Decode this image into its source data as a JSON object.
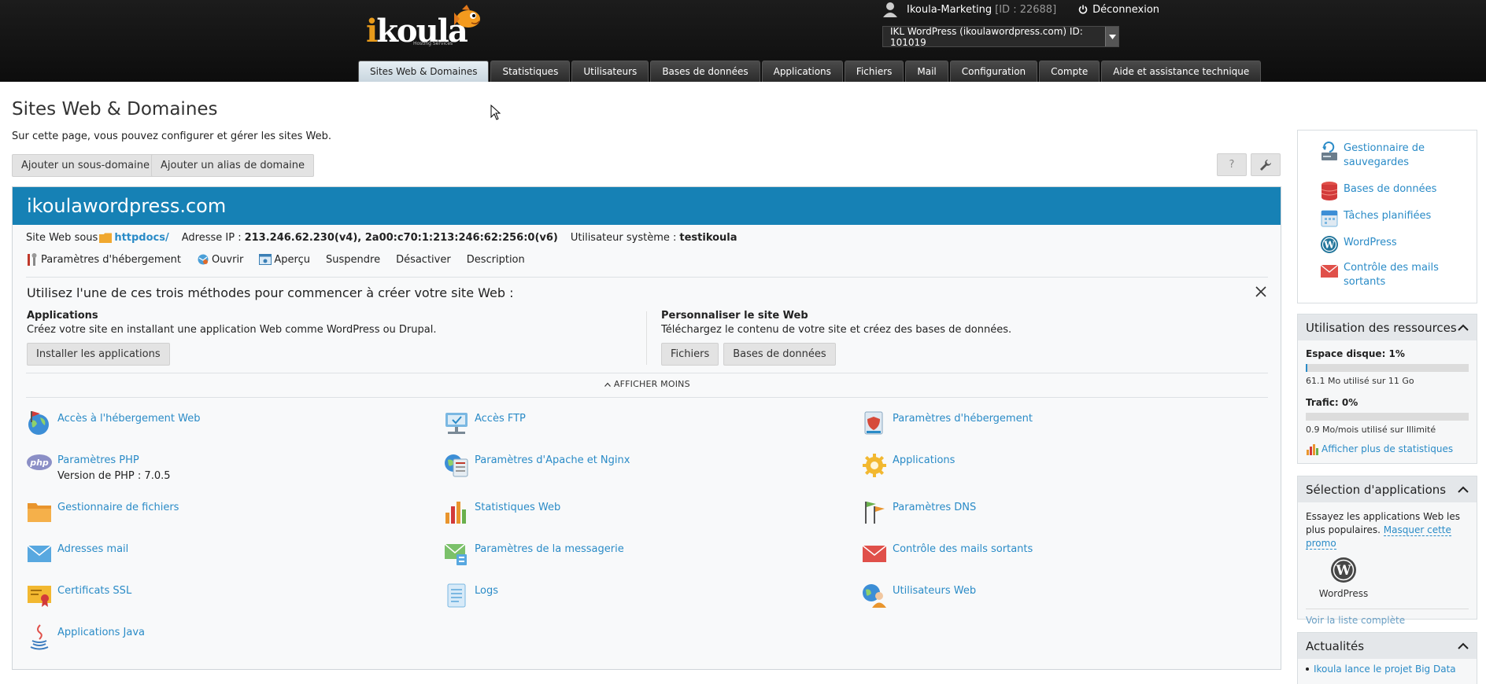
{
  "header": {
    "logo_text": "ikoula",
    "logo_sub": "Hosting Services",
    "user_name": "Ikoula-Marketing",
    "user_id": "[ID : 22688]",
    "logout_label": "Déconnexion",
    "subscription": "IKL WordPress (ikoulawordpress.com) ID: 101019"
  },
  "tabs": [
    {
      "label": "Sites Web & Domaines",
      "active": true
    },
    {
      "label": "Statistiques"
    },
    {
      "label": "Utilisateurs"
    },
    {
      "label": "Bases de données"
    },
    {
      "label": "Applications"
    },
    {
      "label": "Fichiers"
    },
    {
      "label": "Mail"
    },
    {
      "label": "Configuration"
    },
    {
      "label": "Compte"
    },
    {
      "label": "Aide et assistance technique"
    }
  ],
  "main": {
    "title": "Sites Web & Domaines",
    "description": "Sur cette page, vous pouvez configurer et gérer les sites Web.",
    "btn_subdomain": "Ajouter un sous-domaine",
    "btn_alias": "Ajouter un alias de domaine",
    "help_glyph": "?"
  },
  "domain": {
    "name": "ikoulawordpress.com",
    "site_label": "Site Web sous",
    "site_folder": "httpdocs/",
    "ip_label": "Adresse IP :",
    "ip_value": "213.246.62.230(v4), 2a00:c70:1:213:246:62:256:0(v6)",
    "sysuser_label": "Utilisateur système :",
    "sysuser_value": "testikoula",
    "actions": {
      "hosting": "Paramètres d'hébergement",
      "open": "Ouvrir",
      "preview": "Aperçu",
      "suspend": "Suspendre",
      "disable": "Désactiver",
      "description": "Description"
    }
  },
  "promo": {
    "title": "Utilisez l'une de ces trois méthodes pour commencer à créer votre site Web :",
    "left": {
      "heading": "Applications",
      "text": "Créez votre site en installant une application Web comme WordPress ou Drupal.",
      "button": "Installer les applications"
    },
    "right": {
      "heading": "Personnaliser le site Web",
      "text": "Téléchargez le contenu de votre site et créez des bases de données.",
      "button_files": "Fichiers",
      "button_db": "Bases de données"
    },
    "show_less": "AFFICHER MOINS"
  },
  "tools": {
    "web_access": "Accès à l'hébergement Web",
    "ftp": "Accès FTP",
    "hosting_params": "Paramètres d'hébergement",
    "php": "Paramètres PHP",
    "php_version": "Version de PHP : 7.0.5",
    "apache": "Paramètres d'Apache et Nginx",
    "applications": "Applications",
    "file_manager": "Gestionnaire de fichiers",
    "web_stats": "Statistiques Web",
    "dns": "Paramètres DNS",
    "mail_addresses": "Adresses mail",
    "mail_settings": "Paramètres de la messagerie",
    "outgoing_mail": "Contrôle des mails sortants",
    "ssl": "Certificats SSL",
    "logs": "Logs",
    "web_users": "Utilisateurs Web",
    "java": "Applications Java"
  },
  "sidebar": {
    "links": {
      "backup": "Gestionnaire de sauvegardes",
      "databases": "Bases de données",
      "cron": "Tâches planifiées",
      "wordpress": "WordPress",
      "outgoing_mail": "Contrôle des mails sortants"
    },
    "resources": {
      "title": "Utilisation des ressources",
      "disk_label": "Espace disque: 1%",
      "disk_percent": 1,
      "disk_detail": "61.1 Mo utilisé sur 11 Go",
      "traffic_label": "Trafic: 0%",
      "traffic_percent": 0,
      "traffic_detail": "0.9 Mo/mois utilisé sur Illimité",
      "more_stats": "Afficher plus de statistiques"
    },
    "apps": {
      "title": "Sélection d'applications",
      "text": "Essayez les applications Web les plus populaires.",
      "hide_promo": "Masquer cette promo",
      "app_name": "WordPress",
      "full_list": "Voir la liste complète"
    },
    "news": {
      "title": "Actualités",
      "item": "Ikoula lance le projet Big Data"
    }
  },
  "colors": {
    "accent": "#1681b5",
    "link": "#2a8bc7",
    "header_bg": "#111111"
  }
}
